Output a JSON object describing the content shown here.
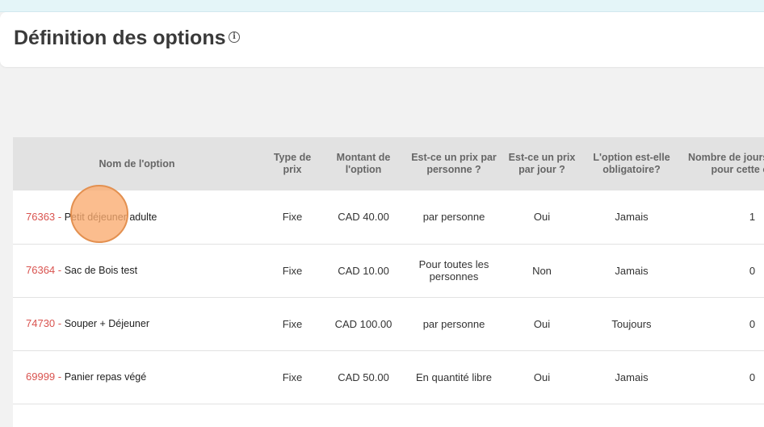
{
  "page": {
    "title": "Définition des options",
    "info_icon": "i"
  },
  "table": {
    "columns": [
      "Nom de l'option",
      "Type de prix",
      "Montant de l'option",
      "Est-ce un prix par personne ?",
      "Est-ce un prix par jour ?",
      "L'option est-elle obligatoire?",
      "Nombre de jours du séjour pour cette option"
    ],
    "rows": [
      {
        "id": "76363",
        "sep": " - ",
        "name": "Petit déjeuner adulte",
        "price_type": "Fixe",
        "amount": "CAD 40.00",
        "per_person": "par personne",
        "per_day": "Oui",
        "mandatory": "Jamais",
        "days": "1"
      },
      {
        "id": "76364",
        "sep": " - ",
        "name": "Sac de Bois test",
        "price_type": "Fixe",
        "amount": "CAD 10.00",
        "per_person": "Pour toutes les personnes",
        "per_day": "Non",
        "mandatory": "Jamais",
        "days": "0"
      },
      {
        "id": "74730",
        "sep": " - ",
        "name": "Souper + Déjeuner",
        "price_type": "Fixe",
        "amount": "CAD 100.00",
        "per_person": "par personne",
        "per_day": "Oui",
        "mandatory": "Toujours",
        "days": "0"
      },
      {
        "id": "69999",
        "sep": " - ",
        "name": "Panier repas végé",
        "price_type": "Fixe",
        "amount": "CAD 50.00",
        "per_person": "En quantité libre",
        "per_day": "Oui",
        "mandatory": "Jamais",
        "days": "0"
      }
    ]
  },
  "colors": {
    "accent_id": "#d9534f",
    "header_bg": "#e2e2e2",
    "click_marker": "#f8a86a"
  }
}
